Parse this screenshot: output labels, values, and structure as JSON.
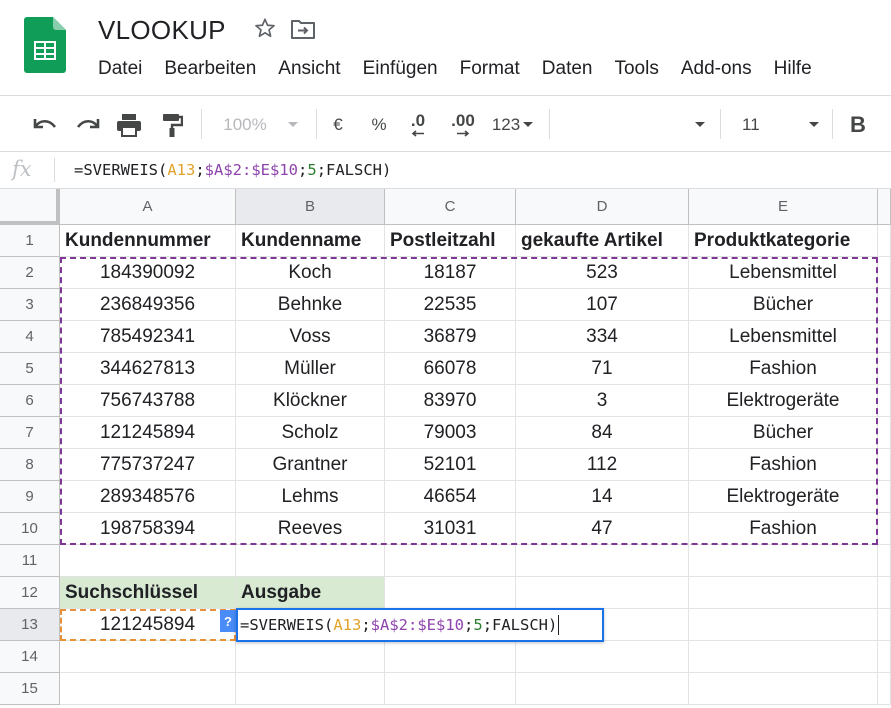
{
  "doc": {
    "title": "VLOOKUP"
  },
  "menu": [
    "Datei",
    "Bearbeiten",
    "Ansicht",
    "Einfügen",
    "Format",
    "Daten",
    "Tools",
    "Add-ons",
    "Hilfe"
  ],
  "toolbar": {
    "zoom": "100%",
    "currency": "€",
    "percent": "%",
    "dec_less": ".0",
    "dec_more": ".00",
    "number_format": "123",
    "font_size": "11",
    "bold": "B"
  },
  "formula_bar": {
    "fx": "fx",
    "formula_parts": [
      "=SVERWEIS(",
      "A13",
      ";",
      "$A$2:$E$10",
      ";",
      "5",
      ";FALSCH)"
    ]
  },
  "columns": [
    "A",
    "B",
    "C",
    "D",
    "E"
  ],
  "rows": [
    "1",
    "2",
    "3",
    "4",
    "5",
    "6",
    "7",
    "8",
    "9",
    "10",
    "11",
    "12",
    "13",
    "14",
    "15"
  ],
  "table": {
    "headers": [
      "Kundennummer",
      "Kundenname",
      "Postleitzahl",
      "gekaufte Artikel",
      "Produktkategorie"
    ],
    "rows": [
      [
        "184390092",
        "Koch",
        "18187",
        "523",
        "Lebensmittel"
      ],
      [
        "236849356",
        "Behnke",
        "22535",
        "107",
        "Bücher"
      ],
      [
        "785492341",
        "Voss",
        "36879",
        "334",
        "Lebensmittel"
      ],
      [
        "344627813",
        "Müller",
        "66078",
        "71",
        "Fashion"
      ],
      [
        "756743788",
        "Klöckner",
        "83970",
        "3",
        "Elektrogeräte"
      ],
      [
        "121245894",
        "Scholz",
        "79003",
        "84",
        "Bücher"
      ],
      [
        "775737247",
        "Grantner",
        "52101",
        "112",
        "Fashion"
      ],
      [
        "289348576",
        "Lehms",
        "46654",
        "14",
        "Elektrogeräte"
      ],
      [
        "198758394",
        "Reeves",
        "31031",
        "47",
        "Fashion"
      ]
    ]
  },
  "lookup": {
    "key_label": "Suchschlüssel",
    "output_label": "Ausgabe",
    "key_value": "121245894",
    "help_badge": "?",
    "editor_parts": [
      "=SVERWEIS(",
      "A13",
      ";",
      "$A$2:$E$10",
      ";",
      "5",
      ";FALSCH)"
    ]
  },
  "colors": {
    "ref_a13": "#e2a32a",
    "ref_range": "#8e44ad",
    "ref_number": "#2e7d32",
    "header_green": "#d9ead3",
    "active_border": "#1a73e8"
  }
}
